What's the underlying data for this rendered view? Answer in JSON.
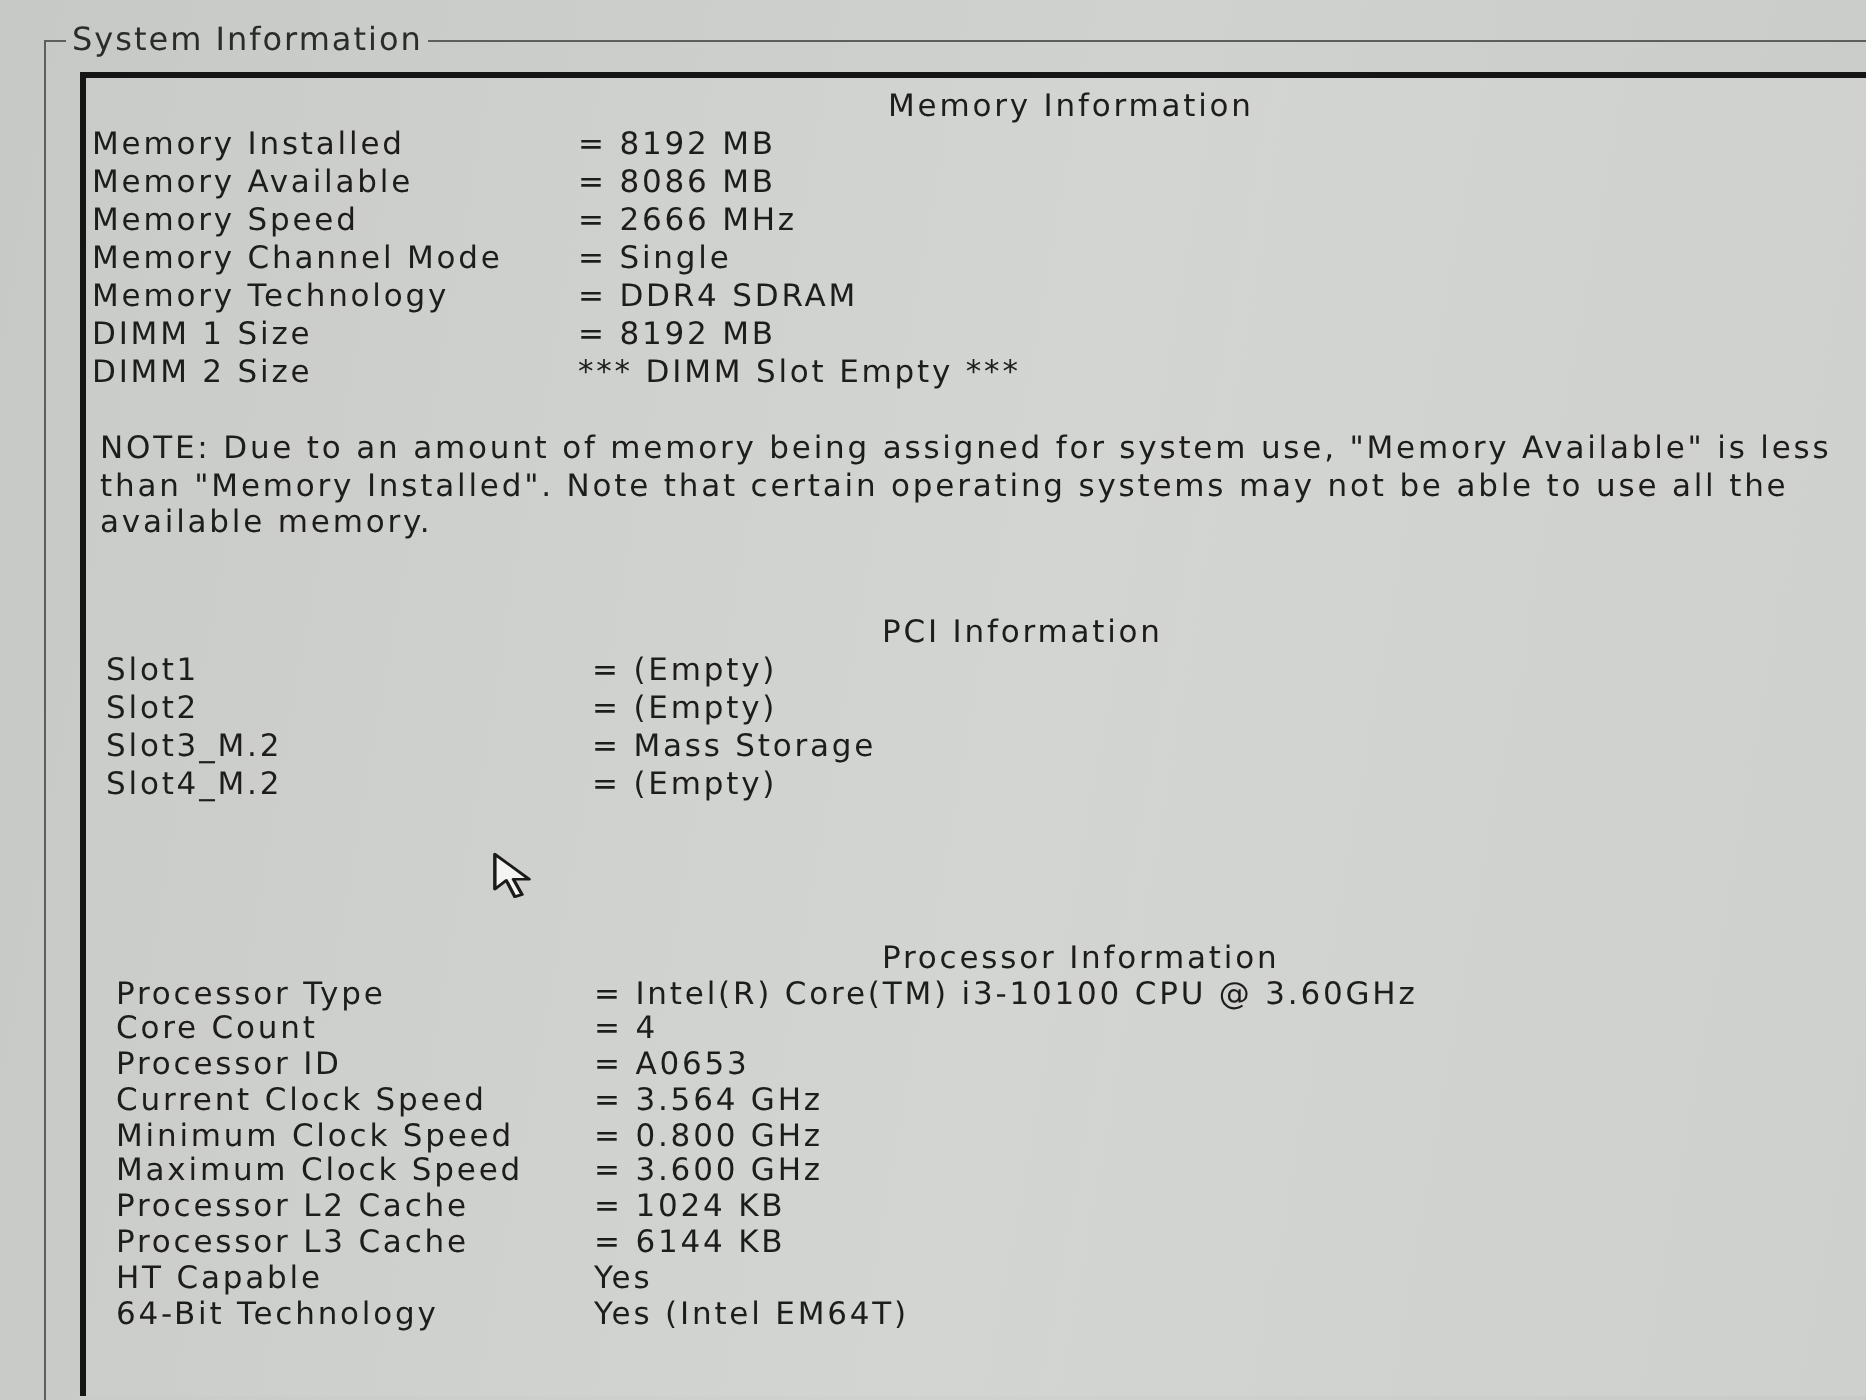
{
  "window": {
    "title": "System Information"
  },
  "sections": [
    {
      "kind": "table",
      "title": "Memory Information",
      "rows": [
        {
          "label": "Memory Installed",
          "value": "= 8192 MB"
        },
        {
          "label": "Memory Available",
          "value": "= 8086 MB"
        },
        {
          "label": "Memory Speed",
          "value": "= 2666 MHz"
        },
        {
          "label": "Memory Channel Mode",
          "value": "= Single"
        },
        {
          "label": "Memory Technology",
          "value": "= DDR4 SDRAM"
        },
        {
          "label": "DIMM 1 Size",
          "value": "= 8192 MB"
        },
        {
          "label": "DIMM 2 Size",
          "value": "*** DIMM Slot Empty ***"
        }
      ]
    },
    {
      "kind": "note",
      "text": "NOTE: Due to an amount of memory being assigned for system use, \"Memory Available\" is less than \"Memory Installed\". Note that certain operating systems may not be able to use all the available memory."
    },
    {
      "kind": "table",
      "title": "PCI Information",
      "rows": [
        {
          "label": "Slot1",
          "value": "= (Empty)"
        },
        {
          "label": "Slot2",
          "value": "= (Empty)"
        },
        {
          "label": "Slot3_M.2",
          "value": "= Mass Storage"
        },
        {
          "label": "Slot4_M.2",
          "value": "= (Empty)"
        }
      ]
    },
    {
      "kind": "table",
      "title": "Processor Information",
      "rows": [
        {
          "label": "Processor Type",
          "value": "= Intel(R) Core(TM) i3-10100 CPU @ 3.60GHz"
        },
        {
          "label": "Core Count",
          "value": "= 4"
        },
        {
          "label": "Processor ID",
          "value": "= A0653"
        },
        {
          "label": "Current Clock Speed",
          "value": "= 3.564 GHz"
        },
        {
          "label": "Minimum Clock Speed",
          "value": "= 0.800 GHz"
        },
        {
          "label": "Maximum Clock Speed",
          "value": "= 3.600 GHz"
        },
        {
          "label": "Processor L2 Cache",
          "value": "= 1024 KB"
        },
        {
          "label": "Processor L3 Cache",
          "value": "= 6144 KB"
        },
        {
          "label": "HT Capable",
          "value": "Yes"
        },
        {
          "label": "64-Bit Technology",
          "value": "Yes (Intel EM64T)"
        }
      ]
    }
  ]
}
